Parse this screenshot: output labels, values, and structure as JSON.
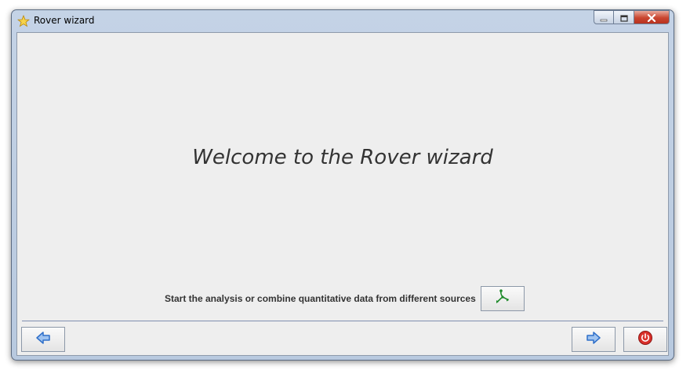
{
  "window": {
    "title": "Rover wizard",
    "icon": "star-icon",
    "controls": [
      "minimize-icon",
      "maximize-icon",
      "close-icon"
    ]
  },
  "main": {
    "welcome": "Welcome to the Rover wizard",
    "start_label": "Start the analysis or combine quantitative data from different sources",
    "start_icon": "pathway-analysis-icon"
  },
  "footer": {
    "back_icon": "arrow-left-icon",
    "next_icon": "arrow-right-icon",
    "exit_icon": "power-icon"
  },
  "colors": {
    "accent_blue": "#2f6fc9",
    "start_green": "#1e8a2a",
    "exit_red": "#c8201c",
    "separator": "#7f8fb0"
  }
}
